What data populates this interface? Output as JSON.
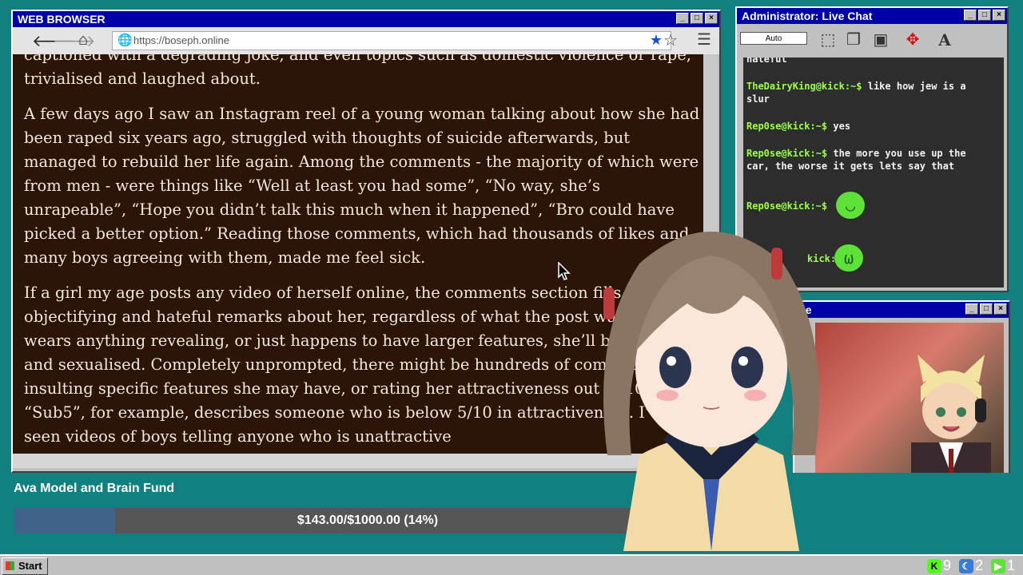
{
  "browser": {
    "title": "WEB BROWSER",
    "url": "https://boseph.online",
    "paragraphs": [
      "captioned with a degrading joke, and even topics such as domestic violence or rape, trivialised and laughed about.",
      "A few days ago I saw an Instagram reel of a young woman talking about how she had been raped six years ago, struggled with thoughts of suicide afterwards, but managed to rebuild her life again. Among the comments - the majority of which were from men - were things like “Well at least you had some”, “No way, she’s unrapeable”, “Hope you didn’t talk this much when it happened”, “Bro could have picked a better option.” Reading those comments, which had thousands of likes and many boys agreeing with them, made me feel sick.",
      "If a girl my age posts any video of herself online, the comments section fills up with objectifying and hateful remarks about her, regardless of what the post was. If she wears anything revealing, or just happens to have larger features, she’ll be abused and sexualised. Completely unprompted, there might be hundreds of comments insulting specific features she may have, or rating her attractiveness out of 10. “Sub5”, for example, describes someone who is below 5/10 in attractiveness. I’ve seen videos of boys telling anyone who is unattractive"
    ]
  },
  "chat": {
    "title": "Administrator: Live Chat",
    "auto_label": "Auto",
    "font_icon": "A",
    "messages": [
      {
        "user": "",
        "text": "hateful"
      },
      {
        "user": "TheDairyKing@kick:~$",
        "text": "like how jew is a slur"
      },
      {
        "user": "Rep0se@kick:~$",
        "text": "yes"
      },
      {
        "user": "Rep0se@kick:~$",
        "text": "the more you use up the car, the worse it gets lets say that"
      },
      {
        "user": "Rep0se@kick:~$",
        "text": ""
      },
      {
        "user": "kick:~$",
        "text": ""
      }
    ]
  },
  "video": {
    "title": "xe"
  },
  "fund": {
    "title": "Ava Model and Brain Fund",
    "progress_text": "$143.00/$1000.00 (14%)",
    "progress_fraction": 0.143
  },
  "taskbar": {
    "start_label": "Start",
    "tray": [
      {
        "icon": "kick-icon",
        "glyph": "K",
        "count": "9",
        "color": "#53fc18"
      },
      {
        "icon": "moon-icon",
        "glyph": "☾",
        "count": "2",
        "color": "#3a7bd5"
      },
      {
        "icon": "play-icon",
        "glyph": "▶",
        "count": "1",
        "color": "#5ee23a"
      }
    ]
  },
  "colors": {
    "desktop": "#138080",
    "titlebar": "#0000a8",
    "article_bg": "#2c1408",
    "chat_user": "#9cff4a",
    "fund_fill": "#426389"
  }
}
